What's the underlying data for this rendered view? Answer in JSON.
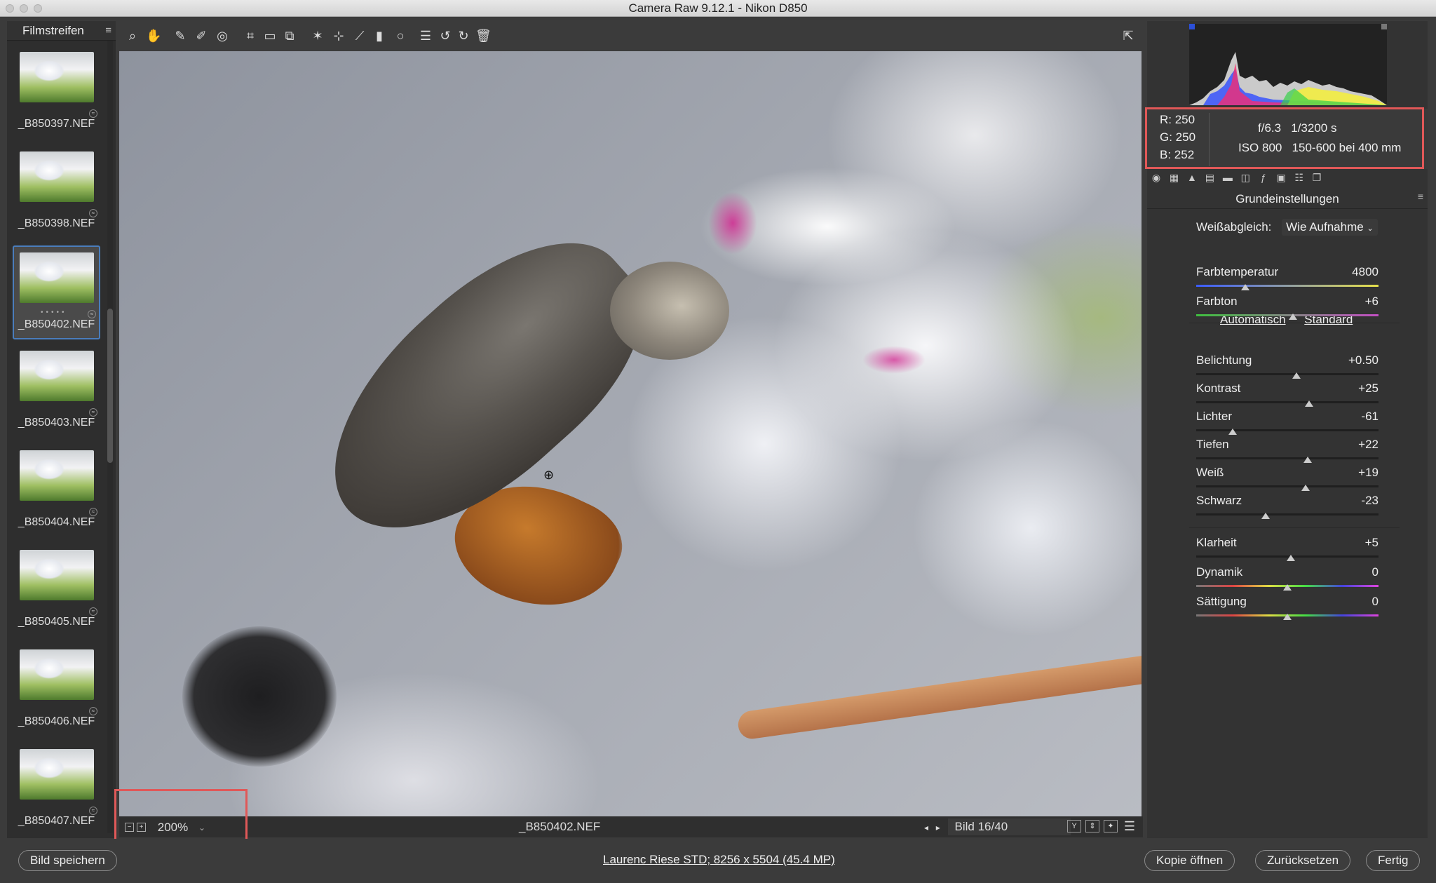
{
  "window": {
    "title": "Camera Raw 9.12.1 - Nikon D850"
  },
  "filmstrip": {
    "title": "Filmstreifen",
    "items": [
      {
        "name": "_B850397.NEF"
      },
      {
        "name": "_B850398.NEF"
      },
      {
        "name": "_B850402.NEF",
        "selected": true
      },
      {
        "name": "_B850403.NEF"
      },
      {
        "name": "_B850404.NEF"
      },
      {
        "name": "_B850405.NEF"
      },
      {
        "name": "_B850406.NEF"
      },
      {
        "name": "_B850407.NEF"
      }
    ]
  },
  "toolbar": {
    "tools": [
      "zoom-tool-icon",
      "hand-tool-icon",
      "white-balance-icon",
      "color-sampler-icon",
      "targeted-adjustment-icon",
      "crop-icon",
      "straighten-icon",
      "transform-icon",
      "spot-removal-icon",
      "red-eye-icon",
      "adjustment-brush-icon",
      "graduated-filter-icon",
      "radial-filter-icon",
      "preferences-icon",
      "rotate-left-icon",
      "rotate-right-icon",
      "trash-icon"
    ],
    "fullscreen_icon": "fullscreen-icon"
  },
  "status": {
    "zoom": "200%",
    "filename": "_B850402.NEF",
    "image_counter": "Bild 16/40"
  },
  "readout": {
    "r": "R: 250",
    "g": "G: 250",
    "b": "B: 252",
    "exif_line1": "f/6.3   1/3200 s",
    "exif_line2": "ISO 800   150-600 bei 400 mm"
  },
  "panel": {
    "title": "Grundeinstellungen",
    "wb_label": "Weißabgleich:",
    "wb_value": "Wie Aufnahme",
    "auto": "Automatisch",
    "standard": "Standard",
    "sliders": [
      {
        "label": "Farbtemperatur",
        "value": "4800",
        "pos": 0.27
      },
      {
        "label": "Farbton",
        "value": "+6",
        "pos": 0.53
      },
      {
        "label": "Belichtung",
        "value": "+0.50",
        "pos": 0.55
      },
      {
        "label": "Kontrast",
        "value": "+25",
        "pos": 0.62
      },
      {
        "label": "Lichter",
        "value": "-61",
        "pos": 0.2
      },
      {
        "label": "Tiefen",
        "value": "+22",
        "pos": 0.61
      },
      {
        "label": "Weiß",
        "value": "+19",
        "pos": 0.6
      },
      {
        "label": "Schwarz",
        "value": "-23",
        "pos": 0.38
      },
      {
        "label": "Klarheit",
        "value": "+5",
        "pos": 0.52
      },
      {
        "label": "Dynamik",
        "value": "0",
        "pos": 0.5
      },
      {
        "label": "Sättigung",
        "value": "0",
        "pos": 0.5
      }
    ]
  },
  "bottom": {
    "save": "Bild speichern",
    "info": "Laurenc Riese STD; 8256 x 5504 (45.4 MP)",
    "open_copy": "Kopie öffnen",
    "reset": "Zurücksetzen",
    "done": "Fertig"
  },
  "colors": {
    "highlight": "#e05858",
    "selection": "#4a7dbc"
  }
}
